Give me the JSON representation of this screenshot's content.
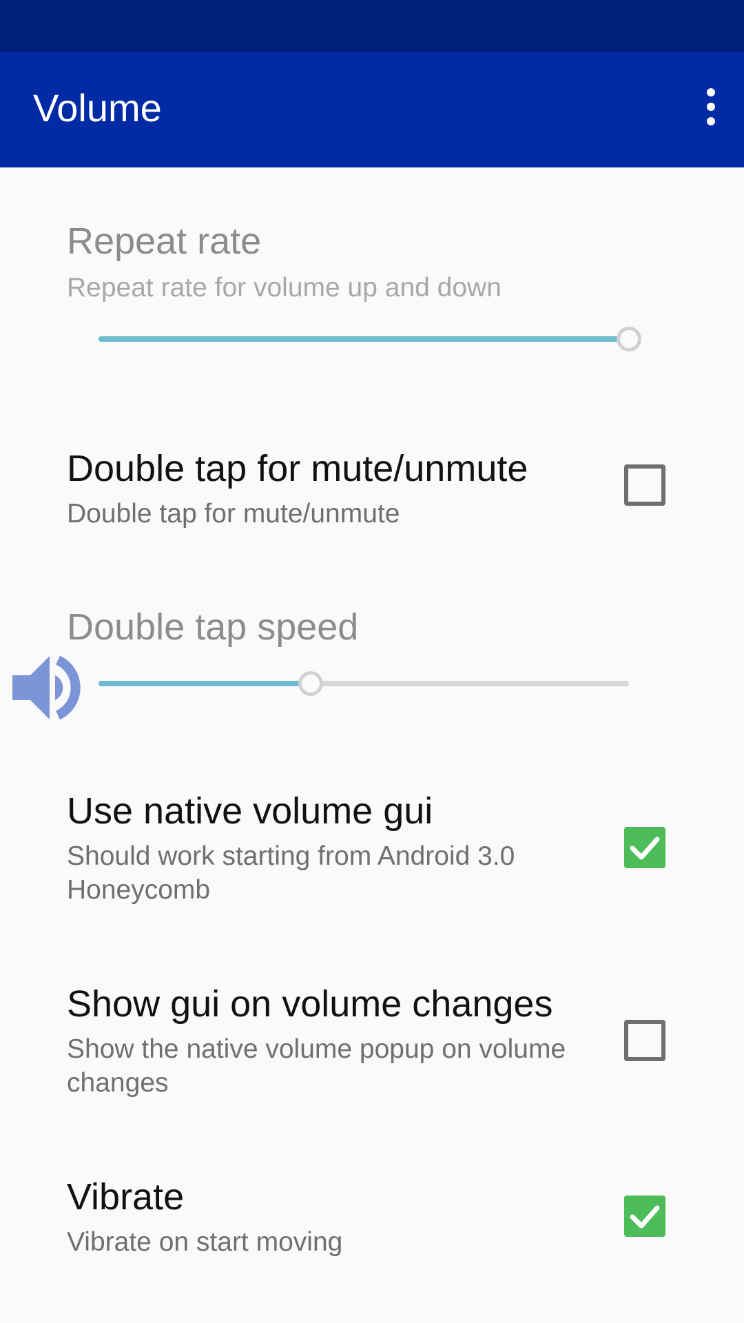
{
  "app_bar": {
    "title": "Volume",
    "overflow_icon": "more-vert-icon",
    "status_bar_color": "#012179",
    "color": "#012aa5"
  },
  "preferences": [
    {
      "title": "Repeat rate",
      "summary": "Repeat rate for volume up and down",
      "type": "slider",
      "enabled": false,
      "value_fraction": 1.0
    },
    {
      "title": "Double tap for mute/unmute",
      "summary": "Double tap for mute/unmute",
      "type": "checkbox",
      "checked": false
    },
    {
      "title": "Double tap speed",
      "type": "slider",
      "enabled": false,
      "value_fraction": 0.4
    },
    {
      "title": "Use native volume gui",
      "summary": "Should work starting from Android 3.0 Honeycomb",
      "type": "checkbox",
      "checked": true
    },
    {
      "title": "Show gui on volume changes",
      "summary": "Show the native volume popup on volume changes",
      "type": "checkbox",
      "checked": false
    },
    {
      "title": "Vibrate",
      "summary": "Vibrate on start moving",
      "type": "checkbox",
      "checked": true
    }
  ],
  "floating_icon": "volume-icon",
  "colors": {
    "accent": "#6fbcd1",
    "checkbox_on": "#4cbd58",
    "volume_icon": "#7b95d6"
  }
}
